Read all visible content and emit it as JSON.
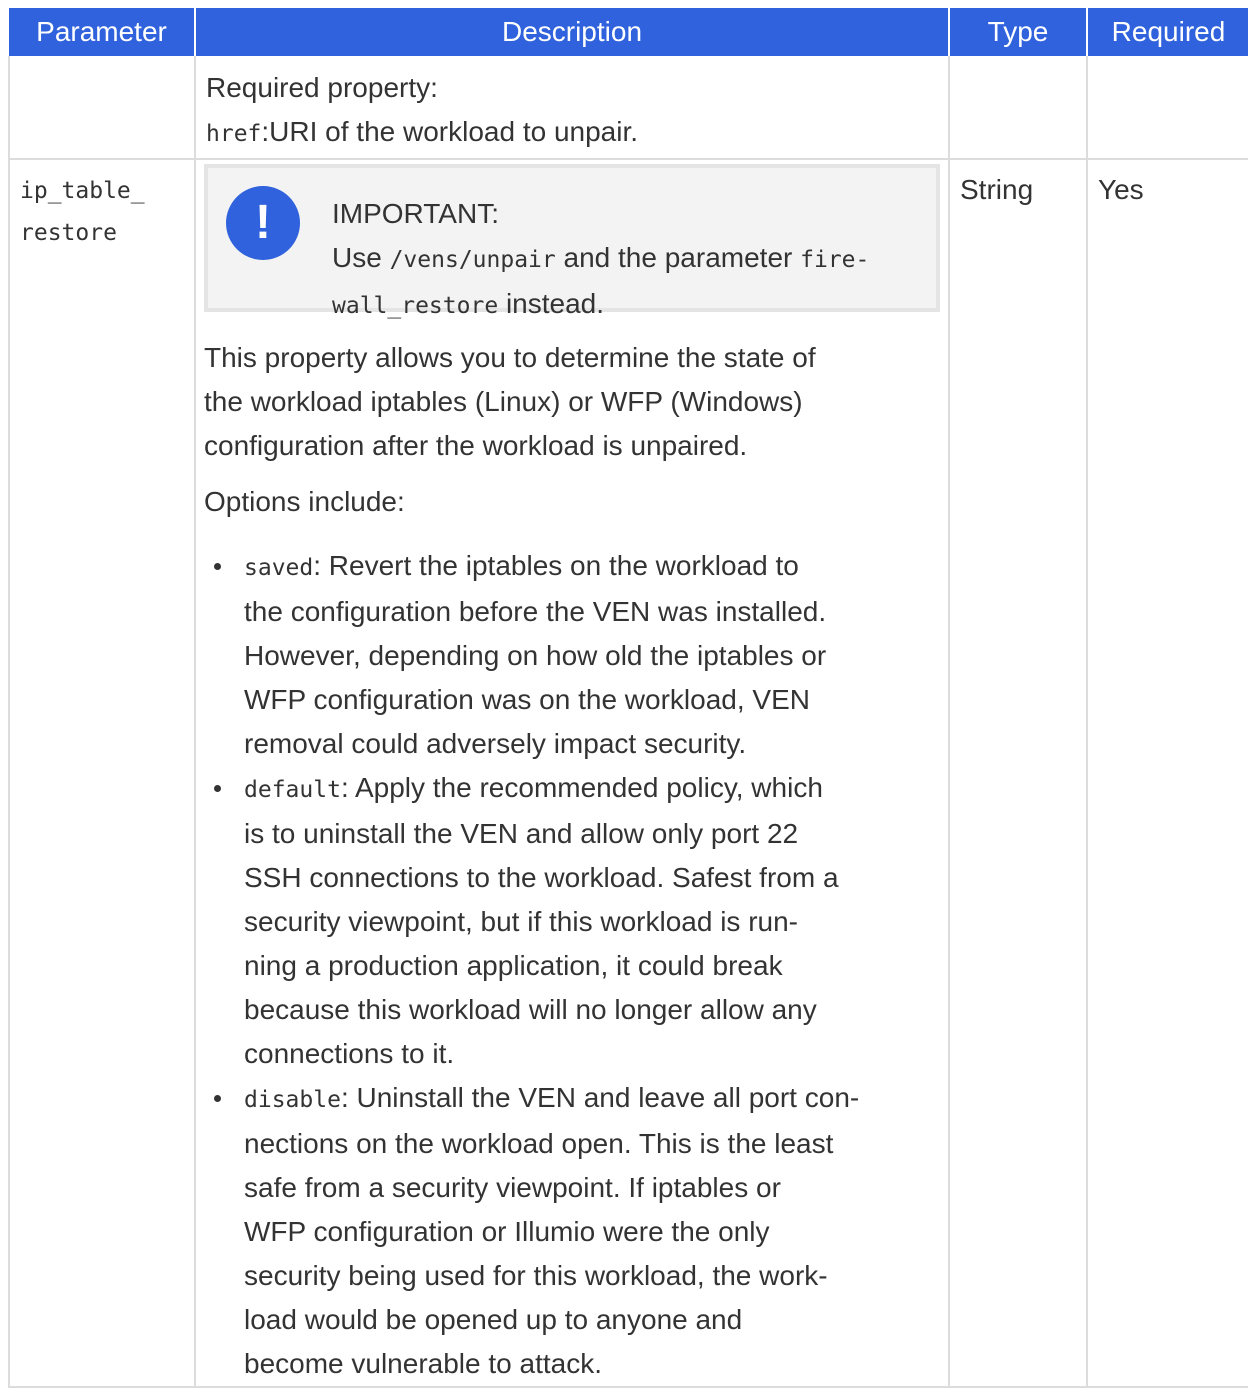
{
  "header": {
    "parameter": "Parameter",
    "description": "Description",
    "type": "Type",
    "required": "Required"
  },
  "row1": {
    "desc_line1": "Required property:",
    "desc_code": "href",
    "desc_line2": ":URI of the workload to unpair."
  },
  "row2": {
    "parameter_line1": "ip_table_",
    "parameter_line2": "restore",
    "type": "String",
    "required": "Yes",
    "important": {
      "icon": "exclamation-icon",
      "title": "IMPORTANT:",
      "use_text": "Use ",
      "code1": "/vens/unpair",
      "mid_text": " and the parameter ",
      "code2a": "fire-",
      "code2b": "wall_restore",
      "end_text": " instead."
    },
    "para1_line1": "This property allows you to determine the state of",
    "para1_line2": "the workload iptables (Linux) or WFP (Windows)",
    "para1_line3": "configuration after the workload is unpaired.",
    "options_label": "Options include:",
    "options": [
      {
        "code": "saved",
        "lines": [
          ": Revert the iptables on the workload to",
          "the configuration before the VEN was installed.",
          "However, depending on how old the iptables or",
          "WFP configuration was on the workload, VEN",
          "removal could adversely impact security."
        ]
      },
      {
        "code": "default",
        "lines": [
          ": Apply the recommended policy, which",
          "is to uninstall the VEN and allow only port 22",
          "SSH connections to the workload. Safest from a",
          "security viewpoint, but if this workload is run-",
          "ning a production application, it could break",
          "because this workload will no longer allow any",
          "connections to it."
        ]
      },
      {
        "code": "disable",
        "lines": [
          ": Uninstall the VEN and leave all port con-",
          "nections on the workload open. This is the least",
          "safe from a security viewpoint. If iptables or",
          "WFP configuration or Illumio were the only",
          "security being used for this workload, the work-",
          "load would be opened up to anyone and",
          "become vulnerable to attack."
        ]
      }
    ]
  }
}
